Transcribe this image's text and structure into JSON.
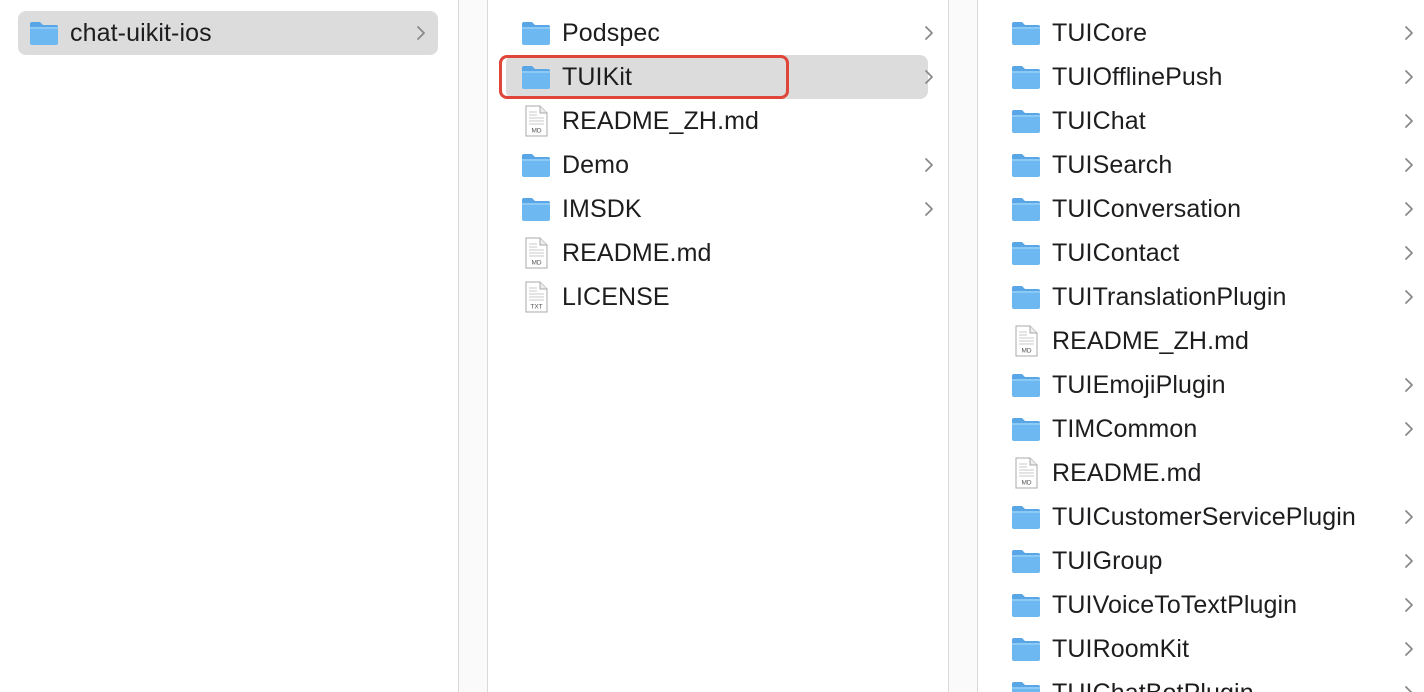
{
  "column1": {
    "items": [
      {
        "label": "chat-uikit-ios",
        "kind": "folder",
        "selected": true,
        "has_children": true
      }
    ]
  },
  "column2": {
    "items": [
      {
        "label": "Podspec",
        "kind": "folder",
        "selected": false,
        "has_children": true
      },
      {
        "label": "TUIKit",
        "kind": "folder",
        "selected": true,
        "has_children": true
      },
      {
        "label": "README_ZH.md",
        "kind": "file",
        "badge": "MD",
        "selected": false,
        "has_children": false
      },
      {
        "label": "Demo",
        "kind": "folder",
        "selected": false,
        "has_children": true
      },
      {
        "label": "IMSDK",
        "kind": "folder",
        "selected": false,
        "has_children": true
      },
      {
        "label": "README.md",
        "kind": "file",
        "badge": "MD",
        "selected": false,
        "has_children": false
      },
      {
        "label": "LICENSE",
        "kind": "file",
        "badge": "TXT",
        "selected": false,
        "has_children": false
      }
    ]
  },
  "column3": {
    "items": [
      {
        "label": "TUICore",
        "kind": "folder",
        "has_children": true
      },
      {
        "label": "TUIOfflinePush",
        "kind": "folder",
        "has_children": true
      },
      {
        "label": "TUIChat",
        "kind": "folder",
        "has_children": true
      },
      {
        "label": "TUISearch",
        "kind": "folder",
        "has_children": true
      },
      {
        "label": "TUIConversation",
        "kind": "folder",
        "has_children": true
      },
      {
        "label": "TUIContact",
        "kind": "folder",
        "has_children": true
      },
      {
        "label": "TUITranslationPlugin",
        "kind": "folder",
        "has_children": true
      },
      {
        "label": "README_ZH.md",
        "kind": "file",
        "badge": "MD",
        "has_children": false
      },
      {
        "label": "TUIEmojiPlugin",
        "kind": "folder",
        "has_children": true
      },
      {
        "label": "TIMCommon",
        "kind": "folder",
        "has_children": true
      },
      {
        "label": "README.md",
        "kind": "file",
        "badge": "MD",
        "has_children": false
      },
      {
        "label": "TUICustomerServicePlugin",
        "kind": "folder",
        "has_children": true
      },
      {
        "label": "TUIGroup",
        "kind": "folder",
        "has_children": true
      },
      {
        "label": "TUIVoiceToTextPlugin",
        "kind": "folder",
        "has_children": true
      },
      {
        "label": "TUIRoomKit",
        "kind": "folder",
        "has_children": true
      },
      {
        "label": "TUIChatBotPlugin",
        "kind": "folder",
        "has_children": true
      }
    ]
  },
  "colors": {
    "folder_body": "#6db8f0",
    "folder_tab": "#58a6e6",
    "selection": "#dcdcdc",
    "highlight_border": "#e0453a",
    "chevron": "#8a8a8a"
  }
}
